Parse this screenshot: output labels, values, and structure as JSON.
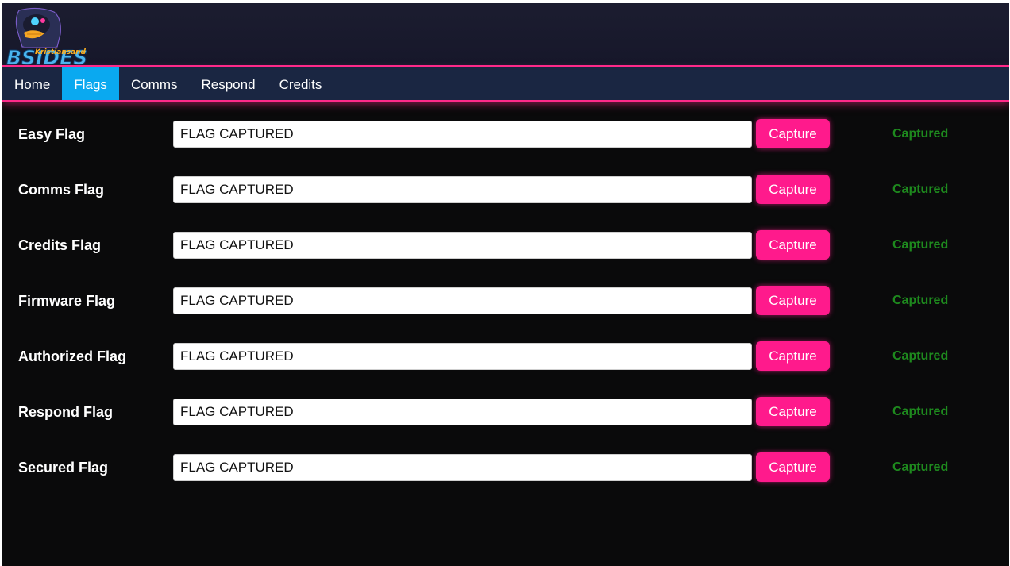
{
  "logo": {
    "title": "BSIDES",
    "subtitle": "Kristiansand"
  },
  "nav": {
    "items": [
      {
        "label": "Home",
        "active": false
      },
      {
        "label": "Flags",
        "active": true
      },
      {
        "label": "Comms",
        "active": false
      },
      {
        "label": "Respond",
        "active": false
      },
      {
        "label": "Credits",
        "active": false
      }
    ]
  },
  "flags": [
    {
      "label": "Easy Flag",
      "value": "FLAG CAPTURED",
      "button": "Capture",
      "status": "Captured"
    },
    {
      "label": "Comms Flag",
      "value": "FLAG CAPTURED",
      "button": "Capture",
      "status": "Captured"
    },
    {
      "label": "Credits Flag",
      "value": "FLAG CAPTURED",
      "button": "Capture",
      "status": "Captured"
    },
    {
      "label": "Firmware Flag",
      "value": "FLAG CAPTURED",
      "button": "Capture",
      "status": "Captured"
    },
    {
      "label": "Authorized Flag",
      "value": "FLAG CAPTURED",
      "button": "Capture",
      "status": "Captured"
    },
    {
      "label": "Respond Flag",
      "value": "FLAG CAPTURED",
      "button": "Capture",
      "status": "Captured"
    },
    {
      "label": "Secured Flag",
      "value": "FLAG CAPTURED",
      "button": "Capture",
      "status": "Captured"
    }
  ],
  "colors": {
    "accent": "#ff1a8c",
    "nav_active": "#0aa9f0",
    "nav_bg": "#1a2642",
    "status": "#1e8a1e",
    "background": "#0a0a0b"
  }
}
